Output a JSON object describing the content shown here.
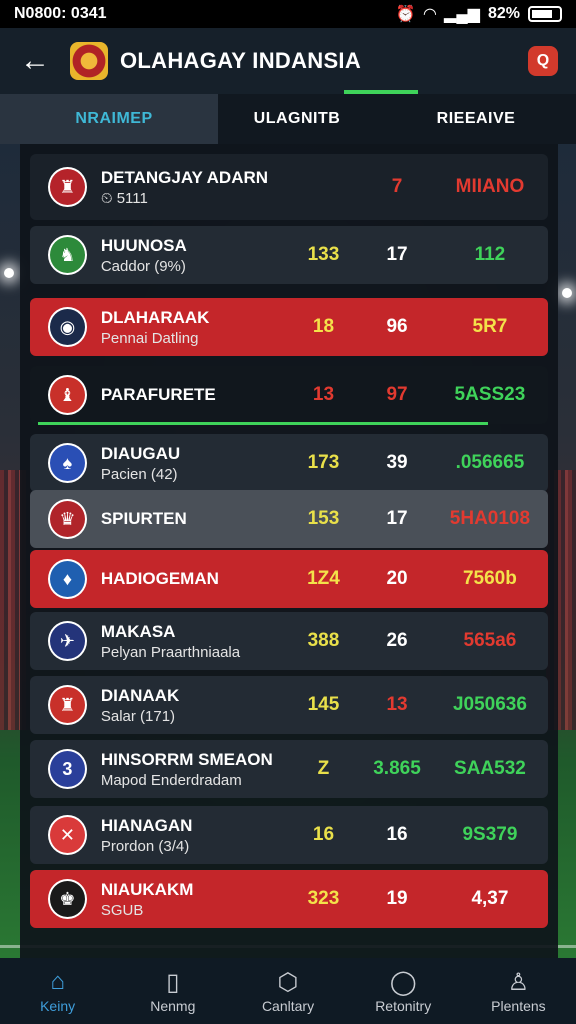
{
  "status_bar": {
    "time": "N0800: 0341",
    "battery": "82%"
  },
  "header": {
    "title": "OLAHAGAY INDANSIA",
    "back_icon": "arrow-left-icon",
    "action_icon": "search-icon"
  },
  "tabs": [
    {
      "label": "NRAIMEP",
      "active": true
    },
    {
      "label": "ULAGNITB",
      "active": false
    },
    {
      "label": "RIEEAIVE",
      "active": false
    }
  ],
  "rows": [
    {
      "name": "DETANGJAY ADARN",
      "sub": "⏲ 5111",
      "c1": "",
      "c2": "7",
      "c3": "MIIANO",
      "style": "header",
      "badge_color": "#b5232a",
      "badge_text": "♜",
      "c1_color": "#e6e6e6",
      "c2_color": "#e23a30",
      "c3_color": "#e23a30"
    },
    {
      "name": "HUUNOSA",
      "sub": "Caddor (9%)",
      "c1": "133",
      "c2": "17",
      "c3": "112",
      "style": "normal",
      "badge_color": "#2d8a3a",
      "badge_text": "♞",
      "c1_color": "#e9e04a",
      "c2_color": "#ffffff",
      "c3_color": "#3fd35a"
    },
    {
      "name": "DLAHARAAK",
      "sub": "Pennai Datling",
      "c1": "18",
      "c2": "96",
      "c3": "5R7",
      "style": "red",
      "badge_color": "#1b2a4a",
      "badge_text": "◉",
      "c1_color": "#f4e24a",
      "c2_color": "#ffffff",
      "c3_color": "#f4e24a"
    },
    {
      "name": "PARAFURETE",
      "sub": "",
      "c1": "13",
      "c2": "97",
      "c3": "5ASS23",
      "style": "dark",
      "badge_color": "#c8302a",
      "badge_text": "♝",
      "c1_color": "#e23a30",
      "c2_color": "#e23a30",
      "c3_color": "#3fd35a"
    },
    {
      "name": "DIAUGAU",
      "sub": "Pacien (42)",
      "c1": "173",
      "c2": "39",
      "c3": ".056665",
      "style": "normal",
      "badge_color": "#2a4fb5",
      "badge_text": "♠",
      "c1_color": "#e9e04a",
      "c2_color": "#ffffff",
      "c3_color": "#3fd35a"
    },
    {
      "name": "SPIURTEN",
      "sub": "",
      "c1": "153",
      "c2": "17",
      "c3": "5HA0108",
      "style": "grey",
      "badge_color": "#b0242a",
      "badge_text": "♛",
      "c1_color": "#e9e04a",
      "c2_color": "#ffffff",
      "c3_color": "#e23a30"
    },
    {
      "name": "HADIOGEMAN",
      "sub": "",
      "c1": "1Z4",
      "c2": "20",
      "c3": "7560b",
      "style": "red",
      "badge_color": "#1f5fb0",
      "badge_text": "♦",
      "c1_color": "#f4e24a",
      "c2_color": "#ffffff",
      "c3_color": "#f4e24a"
    },
    {
      "name": "MAKASA",
      "sub": "Pelyan Praarthniaala",
      "c1": "388",
      "c2": "26",
      "c3": "565a6",
      "style": "normal",
      "badge_color": "#24347a",
      "badge_text": "✈",
      "c1_color": "#e9e04a",
      "c2_color": "#ffffff",
      "c3_color": "#e23a30"
    },
    {
      "name": "DIANAAK",
      "sub": "Salar (171)",
      "c1": "145",
      "c2": "13",
      "c3": "J050636",
      "style": "normal",
      "badge_color": "#c8302a",
      "badge_text": "♜",
      "c1_color": "#e9e04a",
      "c2_color": "#e23a30",
      "c3_color": "#3fd35a"
    },
    {
      "name": "HINSORRM SMEAON",
      "sub": "Mapod Enderdradam",
      "c1": "Z",
      "c2": "3.865",
      "c3": "SAA532",
      "style": "normal",
      "badge_color": "#2a3f9a",
      "badge_text": "3",
      "c1_color": "#e9e04a",
      "c2_color": "#3fd35a",
      "c3_color": "#3fd35a"
    },
    {
      "name": "HIANAGAN",
      "sub": "Prordon (3/4)",
      "c1": "16",
      "c2": "16",
      "c3": "9S379",
      "style": "normal",
      "badge_color": "#d93a3a",
      "badge_text": "✕",
      "c1_color": "#e9e04a",
      "c2_color": "#ffffff",
      "c3_color": "#3fd35a"
    },
    {
      "name": "NIAUKAKM",
      "sub": "SGUB",
      "c1": "323",
      "c2": "19",
      "c3": "4,37",
      "style": "red",
      "badge_color": "#1a1a1a",
      "badge_text": "♚",
      "c1_color": "#f4e24a",
      "c2_color": "#ffffff",
      "c3_color": "#ffffff"
    }
  ],
  "bottom_nav": [
    {
      "label": "Keiny",
      "icon": "home-icon",
      "glyph": "⌂",
      "active": true
    },
    {
      "label": "Nenmg",
      "icon": "book-icon",
      "glyph": "▯",
      "active": false
    },
    {
      "label": "Canltary",
      "icon": "shield-icon",
      "glyph": "⬡",
      "active": false
    },
    {
      "label": "Retonitry",
      "icon": "chat-icon",
      "glyph": "◯",
      "active": false
    },
    {
      "label": "Plentens",
      "icon": "user-icon",
      "glyph": "♙",
      "active": false
    }
  ]
}
